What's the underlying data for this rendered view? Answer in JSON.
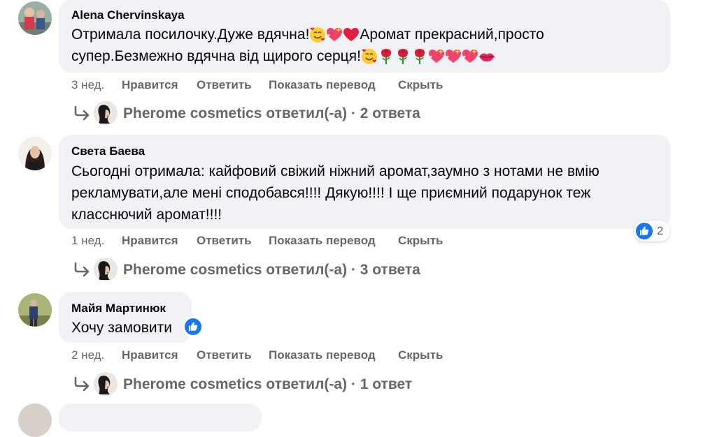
{
  "comments": [
    {
      "author": "Alena Chervinskaya",
      "line1": "Отримала посилочку.Дуже вдячна!",
      "line1_tail": "Аромат прекрасний,просто",
      "line2": "супер.Безмежно вдячна від щирого серця!",
      "time": "3 нед.",
      "replies": "Pherome cosmetics ответил(-а) · 2 ответа"
    },
    {
      "author": "Света Баева",
      "line1": "Сьогодні отримала: кайфовий свіжий ніжний аромат,заумно з нотами не вмію",
      "line2": "рекламувати,але мені сподобався!!!! Дякую!!!! І ще приємний подарунок теж",
      "line3": "класснючий аромат!!!!",
      "time": "1 нед.",
      "reaction_count": "2",
      "replies": "Pherome cosmetics ответил(-а) · 3 ответа"
    },
    {
      "author": "Майя Мартинюк",
      "line1": "Хочу замовити",
      "time": "2 нед.",
      "replies": "Pherome cosmetics ответил(-а) · 1 ответ"
    }
  ],
  "actions": {
    "like": "Нравится",
    "reply": "Ответить",
    "translate": "Показать перевод",
    "hide": "Скрыть"
  },
  "colors": {
    "bubble": "#f0f2f5",
    "meta": "#65676b",
    "like": "#1877f2",
    "heart": "#e41e3f"
  },
  "icons": [
    "smiling-face-with-hearts-icon",
    "sparkling-heart-icon",
    "red-heart-icon",
    "rose-icon",
    "kiss-mark-icon",
    "like-icon",
    "reply-arrow-icon"
  ]
}
